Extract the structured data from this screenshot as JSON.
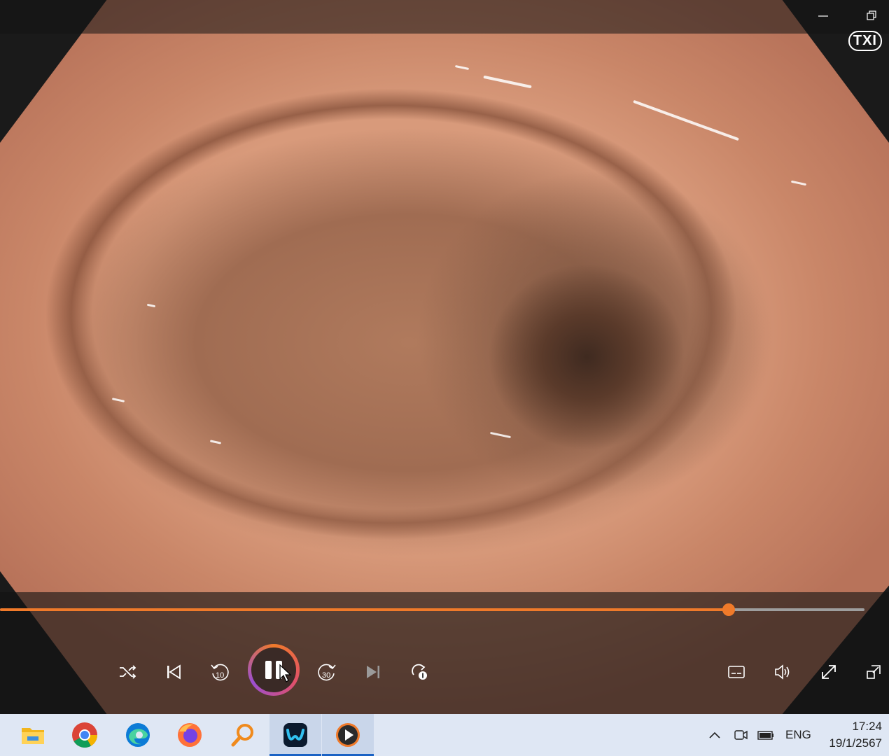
{
  "window": {
    "minimize_icon": "minimize-icon",
    "restore_icon": "restore-icon",
    "watermark": "TXI"
  },
  "player": {
    "progress": 0.843,
    "controls": {
      "shuffle": "shuffle-icon",
      "previous": "skip-previous-icon",
      "rewind_label": "10",
      "play_pause": "pause-icon",
      "forward_label": "30",
      "next": "skip-next-icon",
      "repeat": "repeat-one-icon",
      "captions": "captions-icon",
      "volume": "volume-icon",
      "fullscreen": "fullscreen-icon",
      "miniplayer": "miniplayer-icon"
    }
  },
  "taskbar": {
    "apps": [
      {
        "name": "file-explorer-icon",
        "active": false
      },
      {
        "name": "chrome-icon",
        "active": false
      },
      {
        "name": "edge-icon",
        "active": false
      },
      {
        "name": "firefox-icon",
        "active": false
      },
      {
        "name": "search-tool-icon",
        "active": false
      },
      {
        "name": "webex-icon",
        "active": true
      },
      {
        "name": "media-player-icon",
        "active": true
      }
    ],
    "tray": {
      "language": "ENG",
      "time": "17:24",
      "date": "19/1/2567"
    }
  },
  "colors": {
    "accent": "#f07a2a",
    "taskbar": "#dfe7f4"
  }
}
